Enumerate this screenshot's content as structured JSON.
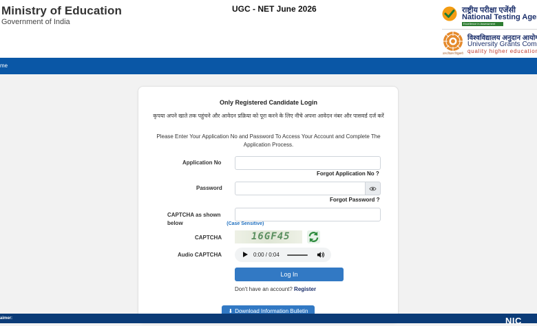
{
  "header": {
    "ministry_title": "Ministry of Education",
    "ministry_subtitle": "Government of India",
    "exam_title": "UGC - NET June 2026",
    "nta": {
      "hindi_name": "राष्ट्रीय परीक्षा एजेंसी",
      "english_name": "National Testing Agency",
      "tagline": "Excellence in Assessment"
    },
    "ugc": {
      "hindi_name": "विश्वविद्यालय अनुदान आयोग",
      "english_name": "University Grants Commission",
      "tagline": "quality higher education",
      "logo_caption": "ज्ञान-विज्ञान विमुक्तये"
    }
  },
  "nav": {
    "home_label": "me"
  },
  "login": {
    "title": "Only Registered Candidate Login",
    "hindi_instruction": "कृपया अपने खाते तक पहुंचने और आवेदन प्रक्रिया को पूरा करने के लिए नीचे अपना आवेदन नंबर और पासवर्ड दर्ज करें",
    "english_instruction": "Please Enter Your Application No and Password To Access Your Account and Complete The Application Process.",
    "application_label": "Application No",
    "application_value": "",
    "forgot_application": "Forgot Application No ?",
    "password_label": "Password",
    "password_value": "",
    "forgot_password": "Forgot Password ?",
    "captcha_input_label": "CAPTCHA as shown below",
    "case_note": "(Case Sensitive)",
    "captcha_value": "",
    "captcha_label": "CAPTCHA",
    "captcha_text": "16GF45",
    "audio_captcha_label": "Audio CAPTCHA",
    "audio_time": "0:00 / 0:04",
    "login_button": "Log In",
    "no_account_text": "Don't have an account?",
    "register_link": "Register",
    "download_button": "Download Information Bulletin"
  },
  "footer": {
    "disclaimer_label": "aimer:",
    "nic_label": "NIC"
  },
  "colors": {
    "nav_blue": "#0a57a6",
    "button_blue": "#3279c4",
    "footer_navy": "#0b3b77",
    "nta_green": "#2e7d32",
    "ugc_orange": "#e58a2c"
  },
  "icons": [
    "nta-logo-icon",
    "ugc-emblem-icon",
    "eye-icon",
    "refresh-icon",
    "play-icon",
    "volume-icon",
    "download-icon"
  ]
}
